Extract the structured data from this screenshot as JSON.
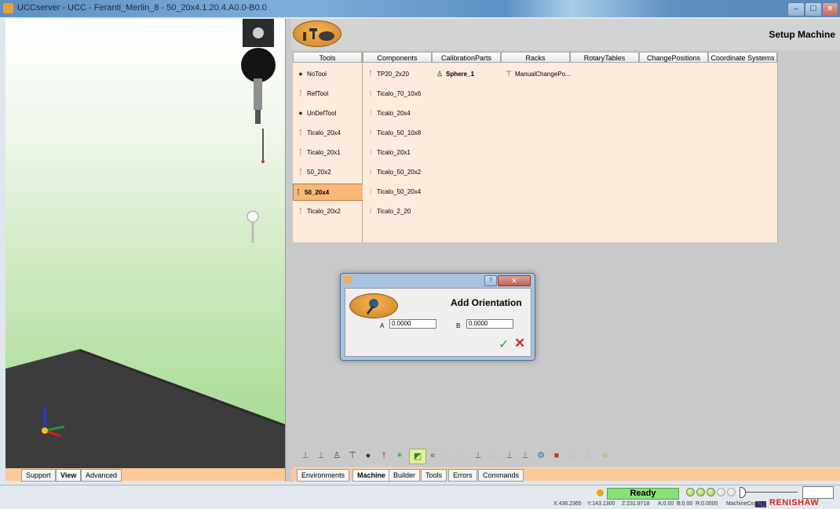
{
  "window": {
    "title": "UCCserver - UCC - Feranti_Merlin_8 - 50_20x4.1.20.4.A0.0-B0.0",
    "minimize": "–",
    "maximize": "☐",
    "close": "✕"
  },
  "header": {
    "title": "Setup Machine"
  },
  "columns": [
    {
      "header": "Tools",
      "items": [
        {
          "label": "NoTool",
          "icon": "probe-filled-icon"
        },
        {
          "label": "RefTool",
          "icon": "probe-icon"
        },
        {
          "label": "UnDefTool",
          "icon": "probe-filled-icon"
        },
        {
          "label": "Ticalo_20x4",
          "icon": "probe-icon"
        },
        {
          "label": "Ticalo_20x1",
          "icon": "probe-icon"
        },
        {
          "label": "50_20x2",
          "icon": "probe-icon"
        },
        {
          "label": "50_20x4",
          "icon": "probe-icon",
          "selected": true
        },
        {
          "label": "Ticalo_20x2",
          "icon": "probe-icon"
        }
      ]
    },
    {
      "header": "Components",
      "items": [
        {
          "label": "TP20_2x20",
          "icon": "probe-icon"
        },
        {
          "label": "Ticalo_70_10x6",
          "icon": "stylus-icon"
        },
        {
          "label": "Ticalo_20x4",
          "icon": "stylus-icon"
        },
        {
          "label": "Ticalo_50_10x8",
          "icon": "stylus-icon"
        },
        {
          "label": "Ticalo_20x1",
          "icon": "stylus-icon"
        },
        {
          "label": "Ticalo_50_20x2",
          "icon": "stylus-icon"
        },
        {
          "label": "Ticalo_50_20x4",
          "icon": "stylus-icon"
        },
        {
          "label": "Ticalo_2_20",
          "icon": "stylus-icon"
        }
      ]
    },
    {
      "header": "CalibrationParts",
      "items": [
        {
          "label": "Sphere_1",
          "icon": "sphere-stand-icon",
          "bold": true
        }
      ]
    },
    {
      "header": "Racks",
      "items": [
        {
          "label": "ManualChangePo...",
          "icon": "rack-icon"
        }
      ]
    },
    {
      "header": "RotaryTables",
      "items": []
    },
    {
      "header": "ChangePositions",
      "items": []
    },
    {
      "header": "Coordinate Systems",
      "items": []
    }
  ],
  "toolbar": {
    "collapse_label": "«"
  },
  "left_tabs": [
    "Support",
    "View",
    "Advanced"
  ],
  "left_active_tab": "View",
  "right_tabs": [
    "Environments",
    "Machine",
    "Builder",
    "Tools",
    "Errors",
    "Commands"
  ],
  "right_active_tab": "Machine",
  "dialog": {
    "title": "Add Orientation",
    "close_label": "✕",
    "a_label": "A",
    "a_value": "0.0000",
    "b_label": "B",
    "b_value": "0.0000",
    "ok_icon": "✓",
    "cancel_icon": "✕"
  },
  "status": {
    "state": "Ready",
    "coords": [
      "X:436.2365",
      "Y:143.1300",
      "Z:231.8718",
      "A:0.00",
      "B:0.00",
      "R:0.0000",
      "MachineCsy"
    ],
    "brand": "RENISHAW"
  },
  "colors": {
    "panel_bg": "#fdebdb",
    "selected_bg": "#f7b878",
    "tab_strip": "#fdc99a",
    "ready_green": "#8ae07c",
    "brand_red": "#e0231c"
  }
}
